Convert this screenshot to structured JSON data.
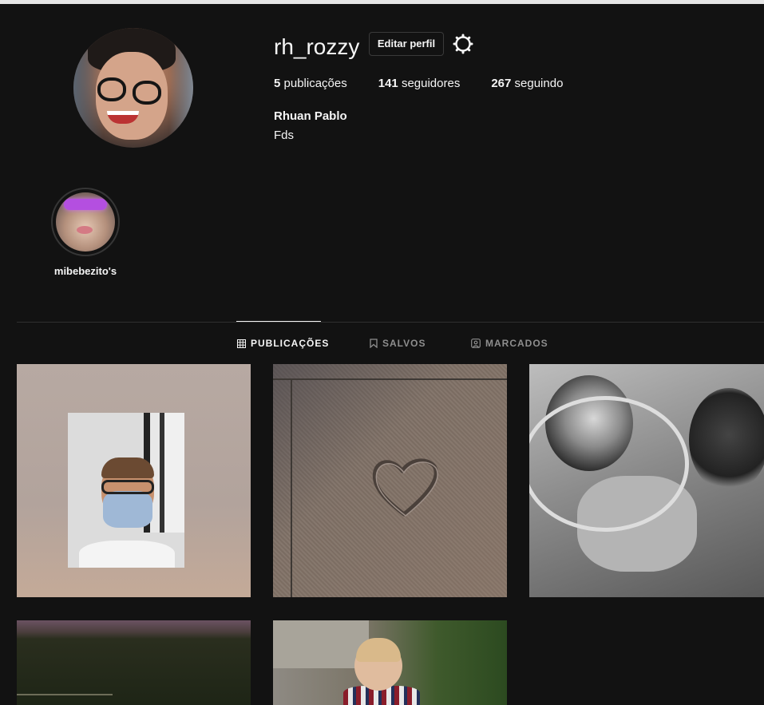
{
  "profile": {
    "username": "rh_rozzy",
    "edit_label": "Editar perfil",
    "full_name": "Rhuan Pablo",
    "bio": "Fds",
    "stats": {
      "posts_count": "5",
      "posts_label": "publicações",
      "followers_count": "141",
      "followers_label": "seguidores",
      "following_count": "267",
      "following_label": "seguindo"
    }
  },
  "highlights": [
    {
      "label": "mibebezito's"
    }
  ],
  "tabs": {
    "posts": "PUBLICAÇÕES",
    "saved": "SALVOS",
    "tagged": "MARCADOS",
    "active": "posts"
  },
  "posts": [
    {
      "icon": "selfie-mask-photo"
    },
    {
      "icon": "heart-on-pavement-photo"
    },
    {
      "icon": "dolls-mirror-photo"
    },
    {
      "icon": "evening-field-photo"
    },
    {
      "icon": "child-photo"
    }
  ],
  "colors": {
    "background": "#121212",
    "text": "#f5f5f5",
    "muted": "#8e8e8e",
    "border": "#363636"
  }
}
